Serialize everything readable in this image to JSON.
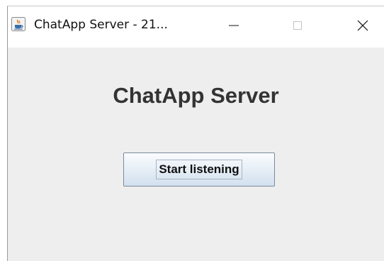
{
  "window": {
    "title": "ChatApp Server - 21..."
  },
  "titlebar": {
    "icons": {
      "app": "java-cup-icon",
      "minimize": "minimize-icon",
      "maximize": "maximize-icon",
      "close": "close-icon"
    }
  },
  "main": {
    "heading": "ChatApp Server",
    "start_button_label": "Start listening"
  }
}
